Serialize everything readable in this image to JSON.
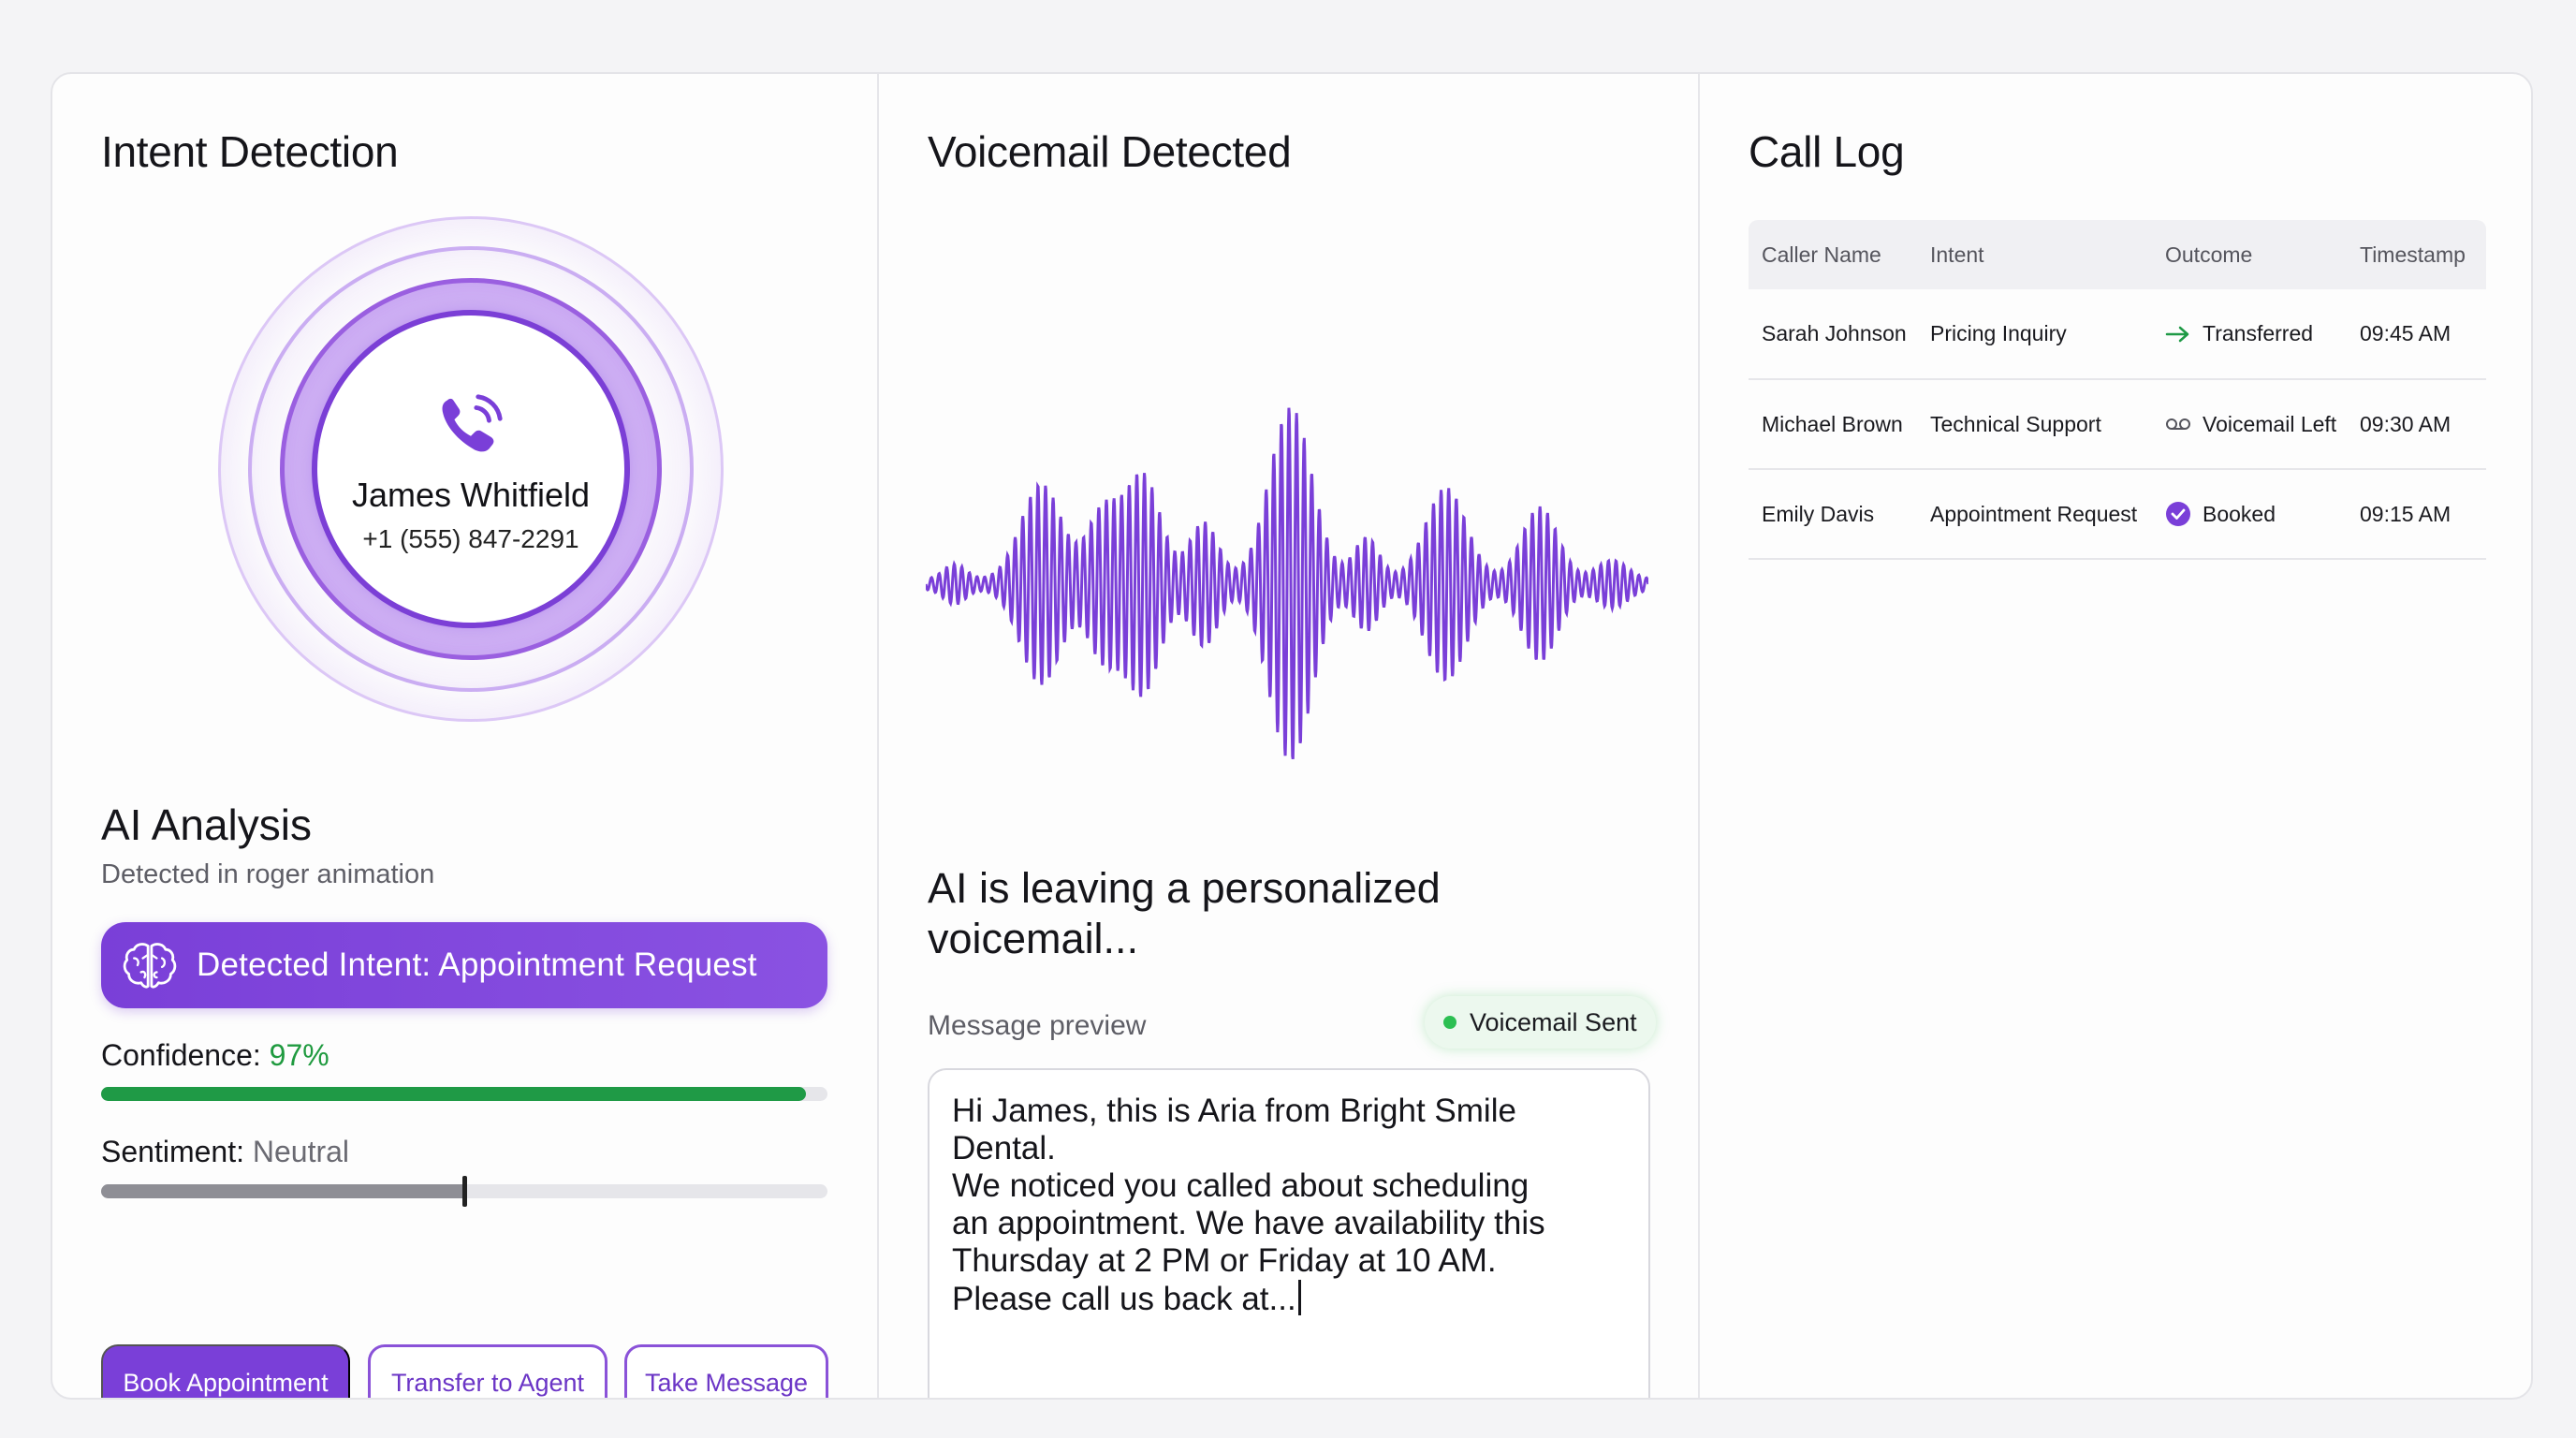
{
  "intent_panel": {
    "title": "Intent Detection",
    "caller": {
      "name": "James Whitfield",
      "phone": "+1 (555) 847-2291"
    },
    "analysis_title": "AI Analysis",
    "analysis_subtitle": "Detected in roger animation",
    "detected_intent": "Detected Intent: Appointment Request",
    "confidence": {
      "label": "Confidence:",
      "value": "97%",
      "fraction": 0.97
    },
    "sentiment": {
      "label": "Sentiment:",
      "value": "Neutral",
      "fraction": 0.5
    },
    "buttons": {
      "book": "Book Appointment",
      "transfer": "Transfer to Agent",
      "message": "Take Message"
    }
  },
  "voicemail_panel": {
    "title": "Voicemail Detected",
    "status_heading": "AI is leaving a personalized voicemail...",
    "preview_label": "Message preview",
    "badge": "Voicemail Sent",
    "message": "Hi James, this is Aria from Bright Smile Dental.\nWe noticed you called about scheduling\nan appointment. We have availability this\nThursday at 2 PM or Friday at 10 AM.\nPlease call us back at..."
  },
  "call_log": {
    "title": "Call Log",
    "columns": [
      "Caller Name",
      "Intent",
      "Outcome",
      "Timestamp"
    ],
    "rows": [
      {
        "caller": "Sarah Johnson",
        "intent": "Pricing Inquiry",
        "outcome": "Transferred",
        "outcome_icon": "arrow-right-icon",
        "time": "09:45 AM"
      },
      {
        "caller": "Michael Brown",
        "intent": "Technical Support",
        "outcome": "Voicemail Left",
        "outcome_icon": "voicemail-icon",
        "time": "09:30 AM"
      },
      {
        "caller": "Emily Davis",
        "intent": "Appointment Request",
        "outcome": "Booked",
        "outcome_icon": "check-circle-icon",
        "time": "09:15 AM"
      }
    ]
  },
  "colors": {
    "accent": "#7a3fd8",
    "success": "#1f9a46",
    "neutral_bar": "#8e8e95",
    "badge_dot": "#2cbf52"
  }
}
